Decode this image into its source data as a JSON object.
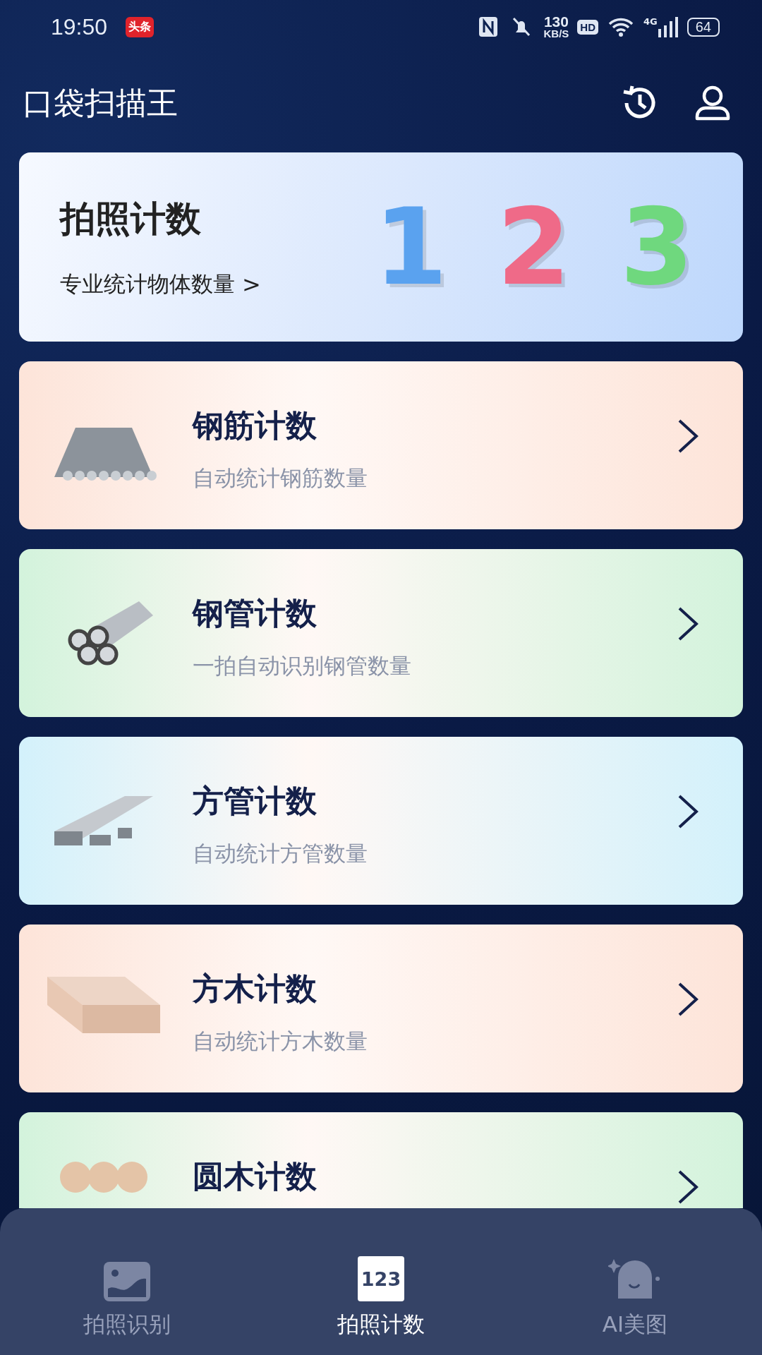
{
  "status_bar": {
    "time": "19:50",
    "app_badge": "头条",
    "speed": "130",
    "speed_unit": "KB/S",
    "hd": "HD",
    "network": "4G",
    "battery": "64"
  },
  "header": {
    "title": "口袋扫描王"
  },
  "hero": {
    "title": "拍照计数",
    "subtitle": "专业统计物体数量",
    "chevron": ">",
    "digits": [
      {
        "text": "1",
        "color": "#5aa2ef"
      },
      {
        "text": "2",
        "color": "#ef6a88"
      },
      {
        "text": "3",
        "color": "#6fd87e"
      }
    ]
  },
  "cards": [
    {
      "title": "钢筋计数",
      "subtitle": "自动统计钢筋数量",
      "color": "#fde4d9",
      "kind": "rebar"
    },
    {
      "title": "钢管计数",
      "subtitle": "一拍自动识别钢管数量",
      "color": "#d3f3dc",
      "kind": "pipe"
    },
    {
      "title": "方管计数",
      "subtitle": "自动统计方管数量",
      "color": "#d3f1fb",
      "kind": "square-tube"
    },
    {
      "title": "方木计数",
      "subtitle": "自动统计方木数量",
      "color": "#fde4d9",
      "kind": "timber"
    },
    {
      "title": "圆木计数",
      "color": "#d3f3dc",
      "kind": "log"
    }
  ],
  "nav": [
    {
      "label": "拍照识别",
      "kind": "image",
      "selected": false
    },
    {
      "label": "拍照计数",
      "kind": "counter",
      "icon_text": "123",
      "selected": true
    },
    {
      "label": "AI美图",
      "kind": "face",
      "selected": false
    }
  ]
}
